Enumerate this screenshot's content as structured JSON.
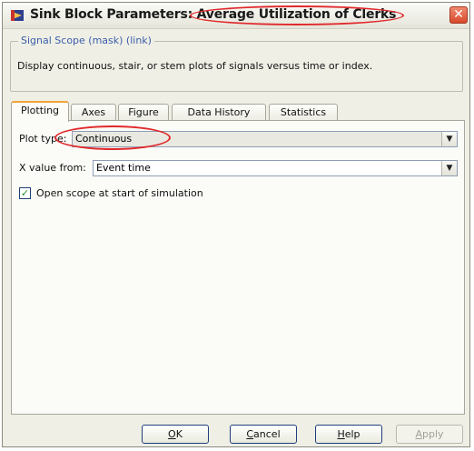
{
  "window": {
    "title_prefix": "Sink Block Parameters: ",
    "title_name": "Average Utilization of Clerks",
    "close_label": "✕"
  },
  "mask": {
    "legend": "Signal Scope (mask) (link)",
    "description": "Display continuous, stair, or stem plots of signals versus time or index."
  },
  "tabs": [
    {
      "label": "Plotting",
      "active": true
    },
    {
      "label": "Axes"
    },
    {
      "label": "Figure"
    },
    {
      "label": "Data History"
    },
    {
      "label": "Statistics"
    }
  ],
  "plotting": {
    "plot_type_label": "Plot type:",
    "plot_type_value": "Continuous",
    "x_value_label": "X value from:",
    "x_value_value": "Event time",
    "open_scope_label": "Open scope at start of simulation",
    "open_scope_checked": true,
    "check_mark": "✓"
  },
  "buttons": {
    "ok": {
      "mnemonic": "O",
      "rest": "K"
    },
    "cancel": {
      "mnemonic": "C",
      "rest": "ancel"
    },
    "help": {
      "mnemonic": "H",
      "rest": "elp"
    },
    "apply": {
      "mnemonic": "A",
      "rest": "pply"
    }
  },
  "colors": {
    "annotation": "#e0292b",
    "legend": "#3b5ea8",
    "active_tab": "#f0a43a"
  }
}
